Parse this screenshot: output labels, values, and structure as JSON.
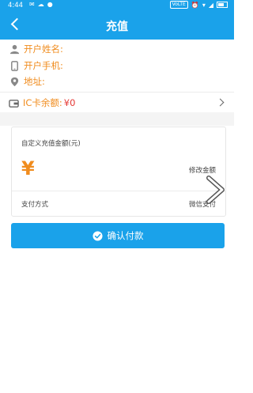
{
  "status_bar": {
    "time": "4:44",
    "volte_label": "VoLTE"
  },
  "header": {
    "title": "充值"
  },
  "account_info": {
    "name_label": "开户姓名:",
    "phone_label": "开户手机:",
    "address_label": "地址:"
  },
  "ic_card": {
    "label": "IC卡余额:",
    "value": "¥0"
  },
  "recharge_card": {
    "custom_amount_label": "自定义充值金额(元)",
    "currency_symbol": "¥",
    "modify_amount_label": "修改金额",
    "payment_method_label": "支付方式",
    "payment_method_value": "微信支付"
  },
  "confirm_button": {
    "label": "确认付款"
  },
  "colors": {
    "primary": "#1aa2ea",
    "accent": "#f08c1e",
    "balance": "#e53935"
  }
}
